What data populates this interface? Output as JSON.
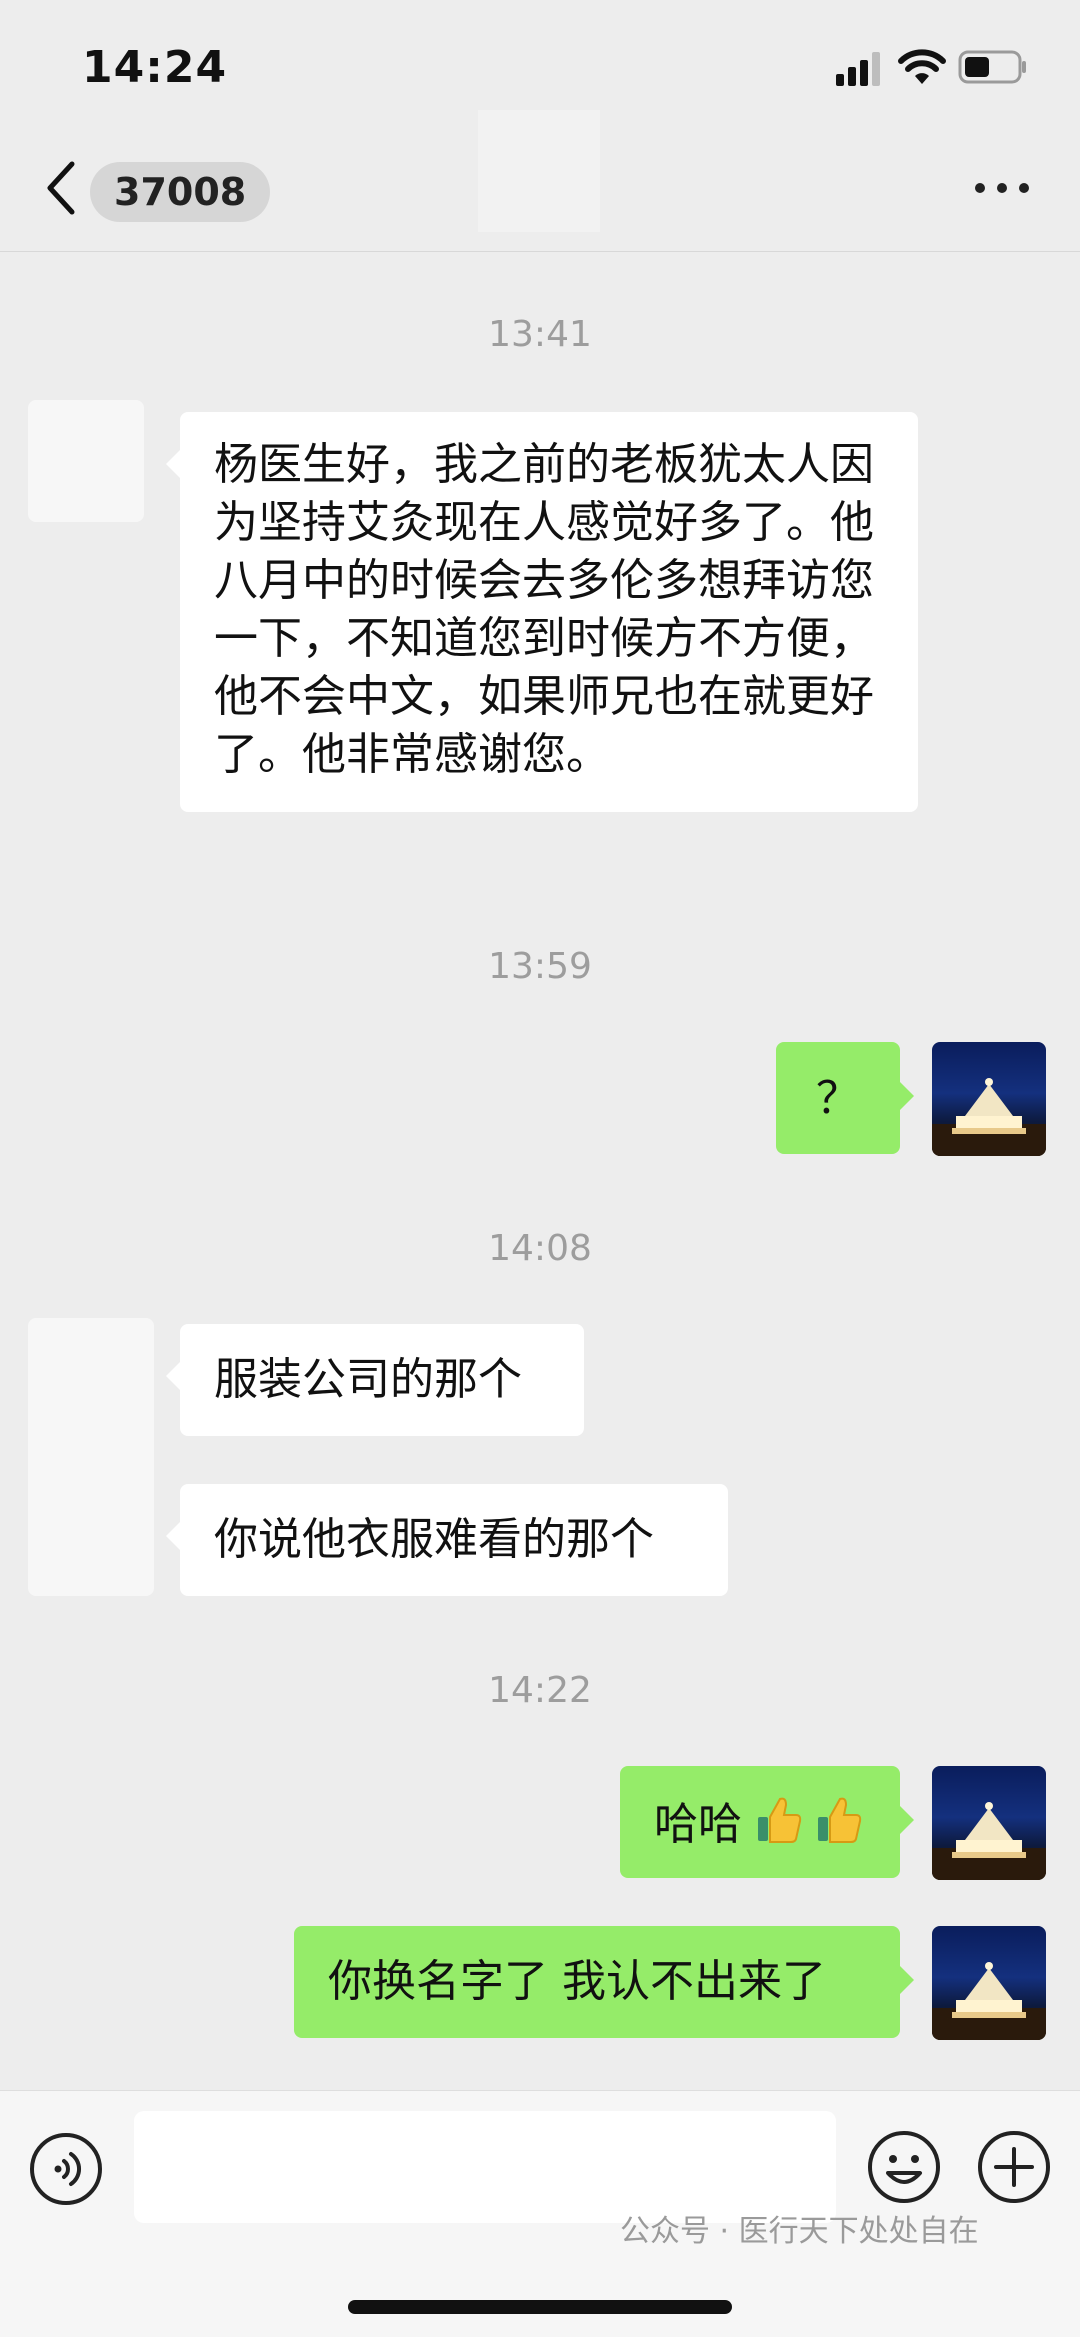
{
  "status_bar": {
    "time": "14:24"
  },
  "header": {
    "contact_id": "37008"
  },
  "messages": [
    {
      "timestamp": "13:41"
    },
    {
      "text": "杨医生好，我之前的老板犹太人因为坚持艾灸现在人感觉好多了。他八月中的时候会去多伦多想拜访您一下，不知道您到时候方不方便，他不会中文，如果师兄也在就更好了。他非常感谢您。"
    },
    {
      "timestamp": "13:59"
    },
    {
      "text": "？"
    },
    {
      "timestamp": "14:08"
    },
    {
      "text": "服装公司的那个"
    },
    {
      "text": "你说他衣服难看的那个"
    },
    {
      "timestamp": "14:22"
    },
    {
      "text": "哈哈"
    },
    {
      "text": "你换名字了 我认不出来了"
    }
  ],
  "watermark": "公众号 · 医行天下处处自在",
  "colors": {
    "outgoing_bubble": "#95ec69",
    "incoming_bubble": "#ffffff",
    "background": "#ededed"
  }
}
